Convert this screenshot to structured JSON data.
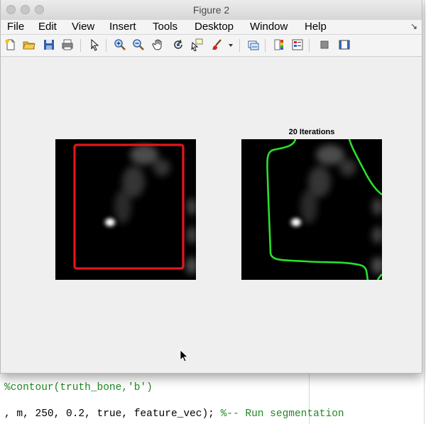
{
  "window": {
    "title": "Figure 2"
  },
  "menu": [
    "File",
    "Edit",
    "View",
    "Insert",
    "Tools",
    "Desktop",
    "Window",
    "Help"
  ],
  "toolbar": [
    "new-figure-icon",
    "open-file-icon",
    "save-icon",
    "print-icon",
    "edit-plot-arrow-icon",
    "zoom-in-icon",
    "zoom-out-icon",
    "pan-hand-icon",
    "rotate-3d-icon",
    "data-cursor-icon",
    "brush-icon",
    "brush-dropdown-icon",
    "link-plot-icon",
    "insert-colorbar-icon",
    "insert-legend-icon",
    "hide-plot-tools-icon",
    "show-plot-tools-icon"
  ],
  "axes_right": {
    "title": "20 Iterations"
  },
  "colors": {
    "initial_contour": "#e8141a",
    "final_contour": "#28e02a",
    "window_bg": "#efefef"
  },
  "editor": {
    "line1": "%contour(truth_bone,'b')",
    "line2_code": ", m, 250, 0.2, true, feature_vec); ",
    "line2_comment": "%-- Run segmentation"
  }
}
